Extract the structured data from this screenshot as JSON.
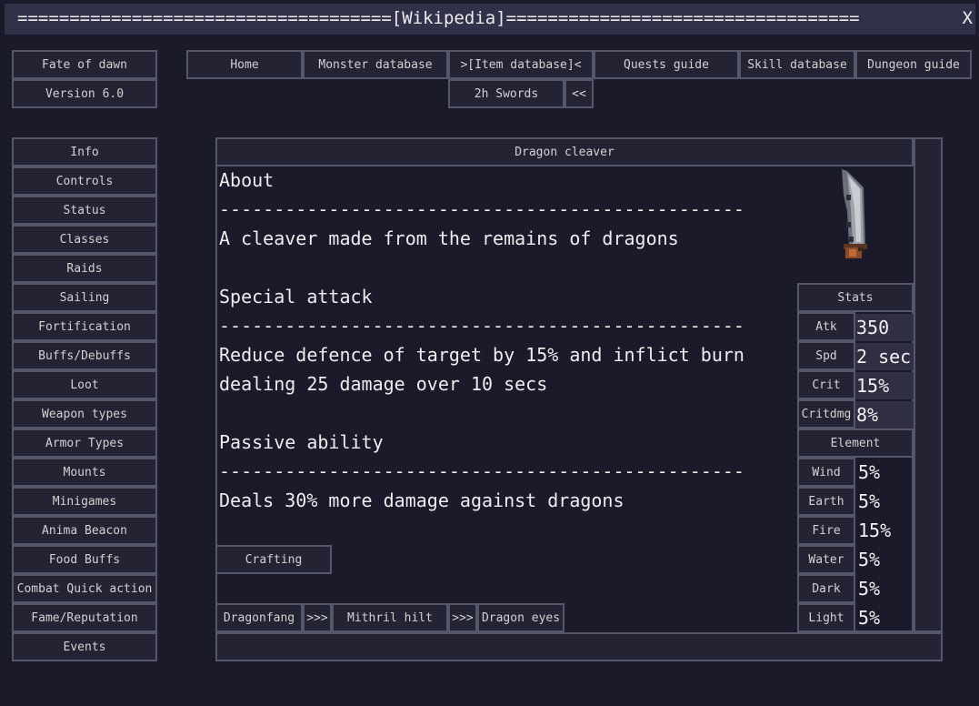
{
  "title_bar": {
    "text": "====================================[Wikipedia]==================================",
    "close": "X"
  },
  "game": {
    "name": "Fate of dawn",
    "version": "Version 6.0"
  },
  "top_nav": {
    "tabs": [
      "Home",
      "Monster database",
      ">[Item database]<",
      "Quests guide",
      "Skill database",
      "Dungeon guide"
    ],
    "sub_tab": "2h Swords",
    "back": "<<"
  },
  "sidebar": {
    "items": [
      "Info",
      "Controls",
      "Status",
      "Classes",
      "Raids",
      "Sailing",
      "Fortification",
      "Buffs/Debuffs",
      "Loot",
      "Weapon types",
      "Armor Types",
      "Mounts",
      "Minigames",
      "Anima Beacon",
      "Food Buffs",
      "Combat Quick action",
      "Fame/Reputation",
      "Events"
    ]
  },
  "item": {
    "name": "Dragon cleaver",
    "divider": "------------------------------------------------",
    "about_heading": "About",
    "about_text": "A cleaver made from the remains of dragons",
    "special_heading": "Special attack",
    "special_line1": "Reduce defence of target by 15% and inflict burn",
    "special_line2": "dealing 25 damage over 10 secs",
    "passive_heading": "Passive ability",
    "passive_text": "Deals 30% more damage against dragons",
    "crafting_label": "Crafting",
    "recipe": {
      "ing1": "Dragonfang",
      "arrow1": ">>>",
      "ing2": "Mithril hilt",
      "arrow2": ">>>",
      "ing3": "Dragon eyes"
    }
  },
  "stats": {
    "header": "Stats",
    "rows": [
      {
        "label": "Atk",
        "value": "350"
      },
      {
        "label": "Spd",
        "value": "2 sec"
      },
      {
        "label": "Crit",
        "value": "15%"
      },
      {
        "label": "Critdmg",
        "value": "8%"
      }
    ]
  },
  "elements": {
    "header": "Element",
    "rows": [
      {
        "label": "Wind",
        "value": "5%"
      },
      {
        "label": "Earth",
        "value": "5%"
      },
      {
        "label": "Fire",
        "value": "15%"
      },
      {
        "label": "Water",
        "value": "5%"
      },
      {
        "label": "Dark",
        "value": "5%"
      },
      {
        "label": "Light",
        "value": "5%"
      }
    ]
  }
}
